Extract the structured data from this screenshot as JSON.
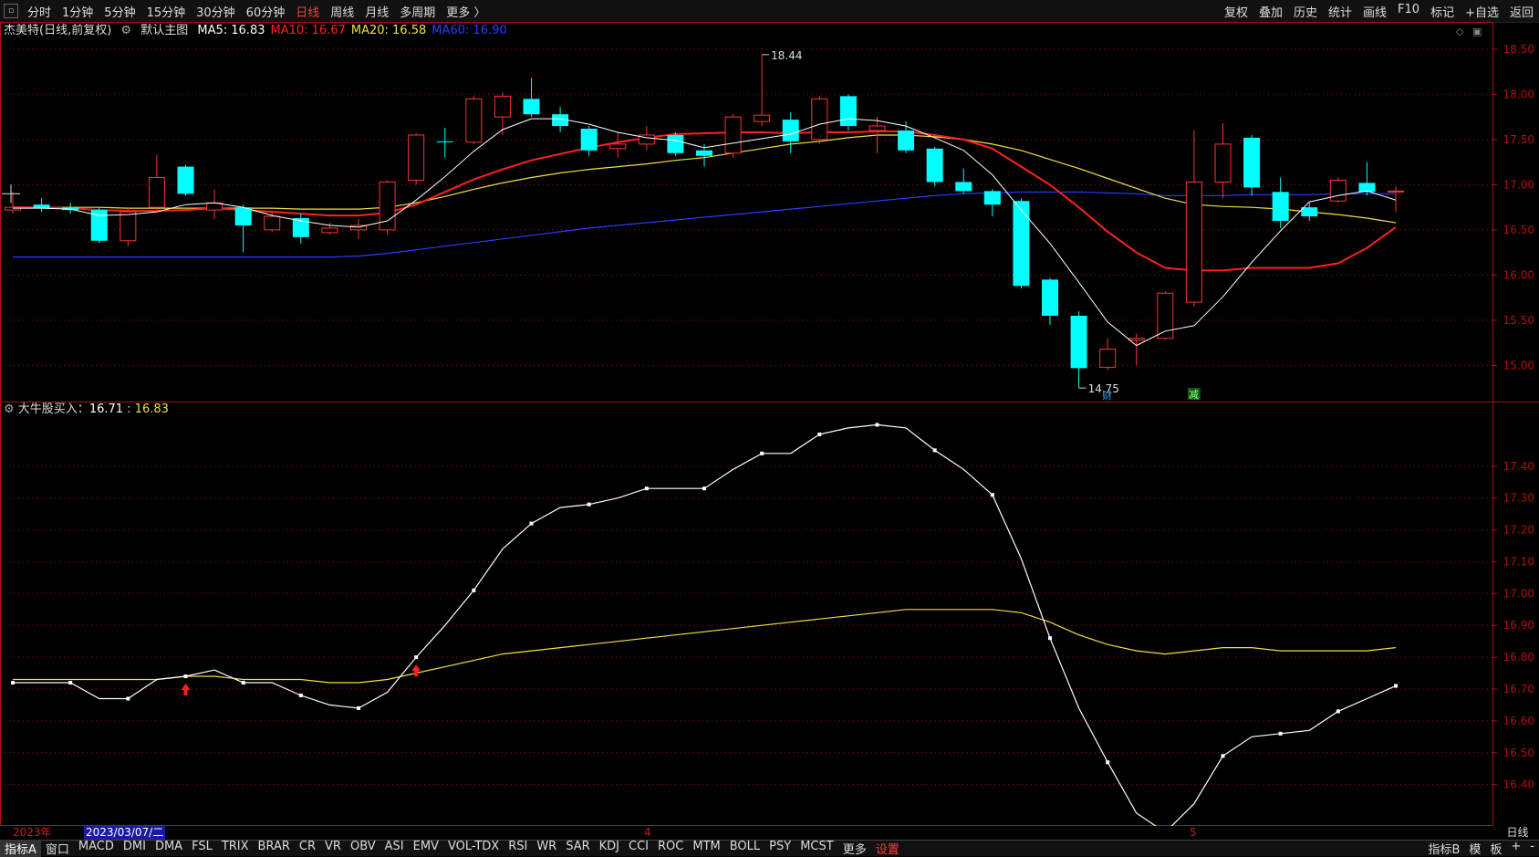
{
  "topbar": {
    "tabs": [
      "分时",
      "1分钟",
      "5分钟",
      "15分钟",
      "30分钟",
      "60分钟",
      "日线",
      "周线",
      "月线",
      "多周期",
      "更多 〉"
    ],
    "active_tab": "日线",
    "tools": [
      "复权",
      "叠加",
      "历史",
      "统计",
      "画线",
      "F10",
      "标记",
      "+自选",
      "返回"
    ]
  },
  "main": {
    "stock_title": "杰美特(日线,前复权)",
    "template_label": "默认主图",
    "ma": [
      {
        "label": "MA5: 16.83",
        "color": "#ffffff"
      },
      {
        "label": "MA10: 16.67",
        "color": "#ff2020"
      },
      {
        "label": "MA20: 16.58",
        "color": "#f0e040"
      },
      {
        "label": "MA60: 16.90",
        "color": "#2a3cff"
      }
    ],
    "high_marker": "18.44",
    "low_marker": "14.75",
    "tag_cai": "财",
    "tag_jian": "减"
  },
  "indicator": {
    "name": "大牛股买入",
    "value1": "16.71",
    "value2": "16.83"
  },
  "datebar": {
    "year": "2023年",
    "cursor_date": "2023/03/07/二",
    "month4": "4",
    "month5": "5",
    "period": "日线"
  },
  "bottombar": {
    "left": [
      "指标A",
      "窗口"
    ],
    "indicators": [
      "MACD",
      "DMI",
      "DMA",
      "FSL",
      "TRIX",
      "BRAR",
      "CR",
      "VR",
      "OBV",
      "ASI",
      "EMV",
      "VOL-TDX",
      "RSI",
      "WR",
      "SAR",
      "KDJ",
      "CCI",
      "ROC",
      "MTM",
      "BOLL",
      "PSY",
      "MCST",
      "更多",
      "设置"
    ],
    "right": [
      "指标B",
      "模",
      "板",
      "+",
      "-"
    ]
  },
  "colors": {
    "up": "#ff3333",
    "down": "#00ffff",
    "ma5": "#ffffff",
    "ma10": "#ff2020",
    "ma20": "#f0e040",
    "ma60": "#2a3cff",
    "axis": "#b01010"
  },
  "chart_data": [
    {
      "type": "candlestick",
      "y_axis_labels": [
        "18.50",
        "18.00",
        "17.50",
        "17.00",
        "16.50",
        "16.00",
        "15.50",
        "15.00"
      ],
      "ylim": [
        14.6,
        18.6
      ],
      "candles": [
        {
          "o": 16.72,
          "c": 16.75,
          "h": 16.92,
          "l": 16.68
        },
        {
          "o": 16.78,
          "c": 16.74,
          "h": 16.85,
          "l": 16.7
        },
        {
          "o": 16.75,
          "c": 16.72,
          "h": 16.8,
          "l": 16.68
        },
        {
          "o": 16.72,
          "c": 16.38,
          "h": 16.75,
          "l": 16.35
        },
        {
          "o": 16.38,
          "c": 16.7,
          "h": 16.74,
          "l": 16.32
        },
        {
          "o": 16.75,
          "c": 17.08,
          "h": 17.33,
          "l": 16.72
        },
        {
          "o": 17.2,
          "c": 16.9,
          "h": 17.22,
          "l": 16.88
        },
        {
          "o": 16.72,
          "c": 16.8,
          "h": 16.95,
          "l": 16.62
        },
        {
          "o": 16.75,
          "c": 16.55,
          "h": 16.78,
          "l": 16.25
        },
        {
          "o": 16.5,
          "c": 16.65,
          "h": 16.7,
          "l": 16.48
        },
        {
          "o": 16.63,
          "c": 16.42,
          "h": 16.68,
          "l": 16.35
        },
        {
          "o": 16.47,
          "c": 16.52,
          "h": 16.58,
          "l": 16.45
        },
        {
          "o": 16.5,
          "c": 16.55,
          "h": 16.62,
          "l": 16.4
        },
        {
          "o": 16.5,
          "c": 17.03,
          "h": 17.05,
          "l": 16.45
        },
        {
          "o": 17.05,
          "c": 17.55,
          "h": 17.57,
          "l": 17.0
        },
        {
          "o": 17.48,
          "c": 17.47,
          "h": 17.63,
          "l": 17.3
        },
        {
          "o": 17.47,
          "c": 17.95,
          "h": 17.98,
          "l": 17.45
        },
        {
          "o": 17.75,
          "c": 17.98,
          "h": 18.02,
          "l": 17.55
        },
        {
          "o": 17.95,
          "c": 17.78,
          "h": 18.18,
          "l": 17.75
        },
        {
          "o": 17.78,
          "c": 17.65,
          "h": 17.86,
          "l": 17.58
        },
        {
          "o": 17.62,
          "c": 17.38,
          "h": 17.65,
          "l": 17.32
        },
        {
          "o": 17.4,
          "c": 17.45,
          "h": 17.58,
          "l": 17.3
        },
        {
          "o": 17.45,
          "c": 17.55,
          "h": 17.65,
          "l": 17.38
        },
        {
          "o": 17.55,
          "c": 17.35,
          "h": 17.58,
          "l": 17.32
        },
        {
          "o": 17.38,
          "c": 17.32,
          "h": 17.45,
          "l": 17.2
        },
        {
          "o": 17.35,
          "c": 17.75,
          "h": 17.78,
          "l": 17.3
        },
        {
          "o": 17.7,
          "c": 17.77,
          "h": 18.44,
          "l": 17.65
        },
        {
          "o": 17.72,
          "c": 17.48,
          "h": 17.8,
          "l": 17.35
        },
        {
          "o": 17.5,
          "c": 17.95,
          "h": 17.98,
          "l": 17.45
        },
        {
          "o": 17.98,
          "c": 17.65,
          "h": 18.0,
          "l": 17.6
        },
        {
          "o": 17.6,
          "c": 17.65,
          "h": 17.75,
          "l": 17.35
        },
        {
          "o": 17.6,
          "c": 17.38,
          "h": 17.7,
          "l": 17.35
        },
        {
          "o": 17.4,
          "c": 17.03,
          "h": 17.42,
          "l": 16.98
        },
        {
          "o": 17.03,
          "c": 16.93,
          "h": 17.18,
          "l": 16.9
        },
        {
          "o": 16.93,
          "c": 16.78,
          "h": 16.95,
          "l": 16.65
        },
        {
          "o": 16.82,
          "c": 15.88,
          "h": 16.85,
          "l": 15.85
        },
        {
          "o": 15.95,
          "c": 15.55,
          "h": 15.97,
          "l": 15.45
        },
        {
          "o": 15.55,
          "c": 14.97,
          "h": 15.6,
          "l": 14.75
        },
        {
          "o": 14.98,
          "c": 15.18,
          "h": 15.3,
          "l": 14.95
        },
        {
          "o": 15.28,
          "c": 15.3,
          "h": 15.35,
          "l": 15.0
        },
        {
          "o": 15.3,
          "c": 15.8,
          "h": 15.82,
          "l": 15.28
        },
        {
          "o": 15.7,
          "c": 17.03,
          "h": 17.6,
          "l": 15.65
        },
        {
          "o": 17.03,
          "c": 17.45,
          "h": 17.68,
          "l": 16.85
        },
        {
          "o": 17.52,
          "c": 16.97,
          "h": 17.55,
          "l": 16.88
        },
        {
          "o": 16.92,
          "c": 16.6,
          "h": 17.08,
          "l": 16.52
        },
        {
          "o": 16.75,
          "c": 16.65,
          "h": 16.8,
          "l": 16.6
        },
        {
          "o": 16.82,
          "c": 17.05,
          "h": 17.08,
          "l": 16.8
        },
        {
          "o": 17.02,
          "c": 16.92,
          "h": 17.25,
          "l": 16.88
        },
        {
          "o": 16.92,
          "c": 16.93,
          "h": 16.98,
          "l": 16.7
        }
      ],
      "ma5": [
        16.74,
        16.74,
        16.73,
        16.66,
        16.67,
        16.7,
        16.78,
        16.8,
        16.75,
        16.66,
        16.6,
        16.55,
        16.53,
        16.6,
        16.83,
        17.09,
        17.37,
        17.61,
        17.73,
        17.73,
        17.67,
        17.58,
        17.52,
        17.49,
        17.41,
        17.46,
        17.51,
        17.56,
        17.67,
        17.73,
        17.71,
        17.65,
        17.52,
        17.38,
        17.11,
        16.72,
        16.35,
        15.92,
        15.48,
        15.22,
        15.38,
        15.44,
        15.76,
        16.14,
        16.49,
        16.81,
        16.88,
        16.93,
        16.83
      ],
      "ma10": [
        16.75,
        16.75,
        16.74,
        16.72,
        16.71,
        16.71,
        16.72,
        16.74,
        16.72,
        16.7,
        16.68,
        16.66,
        16.66,
        16.69,
        16.78,
        16.92,
        17.06,
        17.17,
        17.27,
        17.34,
        17.41,
        17.47,
        17.52,
        17.56,
        17.57,
        17.58,
        17.58,
        17.57,
        17.58,
        17.58,
        17.59,
        17.59,
        17.55,
        17.5,
        17.4,
        17.2,
        17.0,
        16.75,
        16.48,
        16.25,
        16.08,
        16.05,
        16.05,
        16.08,
        16.08,
        16.08,
        16.13,
        16.3,
        16.53
      ],
      "ma20": [
        16.75,
        16.75,
        16.75,
        16.75,
        16.74,
        16.74,
        16.74,
        16.74,
        16.74,
        16.74,
        16.73,
        16.73,
        16.73,
        16.75,
        16.8,
        16.87,
        16.95,
        17.02,
        17.08,
        17.13,
        17.17,
        17.2,
        17.23,
        17.27,
        17.3,
        17.35,
        17.4,
        17.45,
        17.48,
        17.52,
        17.55,
        17.55,
        17.53,
        17.5,
        17.45,
        17.38,
        17.28,
        17.18,
        17.07,
        16.96,
        16.85,
        16.78,
        16.76,
        16.75,
        16.73,
        16.7,
        16.67,
        16.63,
        16.58
      ],
      "ma60": [
        16.2,
        16.2,
        16.2,
        16.2,
        16.2,
        16.2,
        16.2,
        16.2,
        16.2,
        16.2,
        16.2,
        16.2,
        16.21,
        16.24,
        16.28,
        16.32,
        16.36,
        16.4,
        16.44,
        16.48,
        16.52,
        16.55,
        16.58,
        16.61,
        16.64,
        16.67,
        16.7,
        16.73,
        16.76,
        16.79,
        16.82,
        16.85,
        16.88,
        16.9,
        16.91,
        16.92,
        16.92,
        16.92,
        16.91,
        16.9,
        16.88,
        16.88,
        16.88,
        16.89,
        16.89,
        16.89,
        16.9,
        16.9,
        16.9
      ]
    },
    {
      "type": "line",
      "y_axis_labels": [
        "17.40",
        "17.30",
        "17.20",
        "17.10",
        "17.00",
        "16.90",
        "16.80",
        "16.70",
        "16.60",
        "16.50",
        "16.40"
      ],
      "ylim": [
        16.27,
        17.58
      ],
      "white": [
        16.72,
        16.72,
        16.72,
        16.67,
        16.67,
        16.73,
        16.74,
        16.76,
        16.72,
        16.72,
        16.68,
        16.65,
        16.64,
        16.69,
        16.8,
        16.9,
        17.01,
        17.14,
        17.22,
        17.27,
        17.28,
        17.3,
        17.33,
        17.33,
        17.33,
        17.39,
        17.44,
        17.44,
        17.5,
        17.52,
        17.53,
        17.52,
        17.45,
        17.39,
        17.31,
        17.11,
        16.86,
        16.64,
        16.47,
        16.31,
        16.25,
        16.34,
        16.49,
        16.55,
        16.56,
        16.57,
        16.63,
        16.67,
        16.71
      ],
      "yellow": [
        16.73,
        16.73,
        16.73,
        16.73,
        16.73,
        16.73,
        16.74,
        16.74,
        16.73,
        16.73,
        16.73,
        16.72,
        16.72,
        16.73,
        16.75,
        16.77,
        16.79,
        16.81,
        16.82,
        16.83,
        16.84,
        16.85,
        16.86,
        16.87,
        16.88,
        16.89,
        16.9,
        16.91,
        16.92,
        16.93,
        16.94,
        16.95,
        16.95,
        16.95,
        16.95,
        16.94,
        16.91,
        16.87,
        16.84,
        16.82,
        16.81,
        16.82,
        16.83,
        16.83,
        16.82,
        16.82,
        16.82,
        16.82,
        16.83
      ],
      "buy_signals": [
        6,
        14
      ]
    }
  ]
}
